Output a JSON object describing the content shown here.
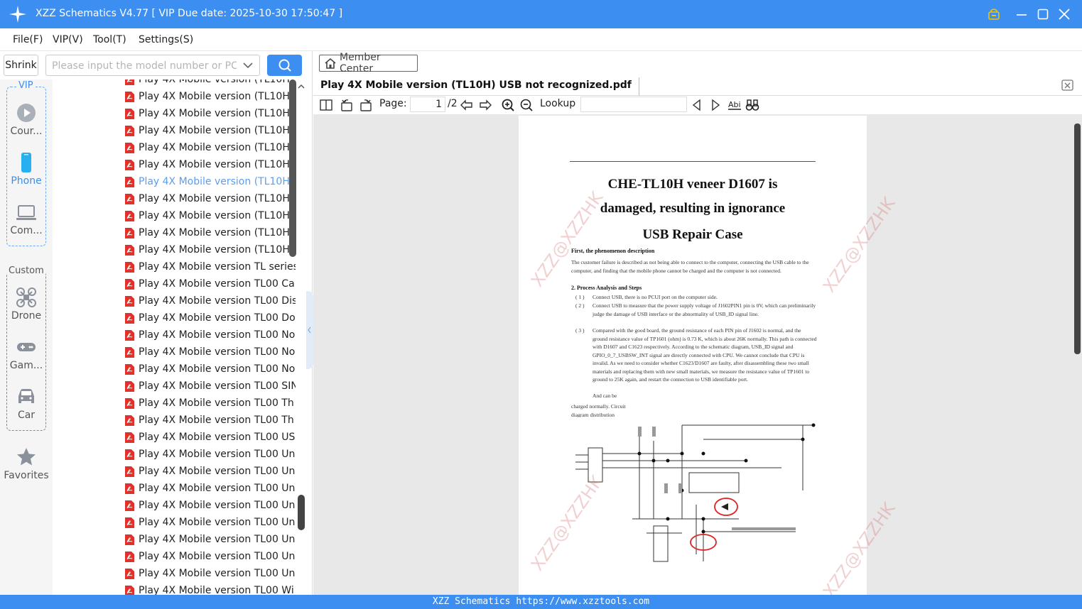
{
  "app": {
    "title": "XZZ Schematics V4.77 [ VIP Due date: 2025-10-30 17:50:47 ]",
    "accent_color": "#3c8ef0"
  },
  "menu": [
    "File(F)",
    "VIP(V)",
    "Tool(T)",
    "Settings(S)"
  ],
  "left": {
    "shrink_label": "Shrink",
    "search_placeholder": "Please input the model number or PCB",
    "vip_label": "VIP",
    "custom_label": "Custom",
    "categories_vip": [
      {
        "label": "Cour...",
        "icon": "play-circle-icon"
      },
      {
        "label": "Phone",
        "icon": "phone-icon"
      },
      {
        "label": "Com...",
        "icon": "laptop-icon"
      }
    ],
    "categories_custom": [
      {
        "label": "Drone",
        "icon": "drone-icon"
      },
      {
        "label": "Gam...",
        "icon": "gamepad-icon"
      },
      {
        "label": "Car",
        "icon": "car-icon"
      }
    ],
    "favorites_label": "Favorites",
    "files": [
      "Play 4X Mobile version (TL10H)",
      "Play 4X Mobile version (TL10H)",
      "Play 4X Mobile version (TL10H)",
      "Play 4X Mobile version (TL10H)",
      "Play 4X Mobile version (TL10H)",
      "Play 4X Mobile version (TL10H)",
      "Play 4X Mobile version (TL10H)",
      "Play 4X Mobile version (TL10H)",
      "Play 4X Mobile version (TL10H)",
      "Play 4X Mobile version (TL10H)",
      "Play 4X Mobile version (TL10H)",
      "Play 4X Mobile version TL series",
      "Play 4X Mobile version TL00 Ca:",
      "Play 4X Mobile version TL00 Dis",
      "Play 4X Mobile version TL00 Do",
      "Play 4X Mobile version TL00 No",
      "Play 4X Mobile version TL00 No",
      "Play 4X Mobile version TL00 No",
      "Play 4X Mobile version TL00 SIN",
      "Play 4X Mobile version TL00 Th",
      "Play 4X Mobile version TL00 Th",
      "Play 4X Mobile version TL00 US",
      "Play 4X Mobile version TL00 Un",
      "Play 4X Mobile version TL00 Un",
      "Play 4X Mobile version TL00 Un",
      "Play 4X Mobile version TL00 Un",
      "Play 4X Mobile version TL00 Un",
      "Play 4X Mobile version TL00 Un",
      "Play 4X Mobile version TL00 Un",
      "Play 4X Mobile version TL00 Un",
      "Play 4X Mobile version TL00 Wi"
    ],
    "selected_index": 6
  },
  "right": {
    "member_center": "Member Center",
    "tab_title": "Play 4X Mobile version (TL10H) USB not recognized.pdf",
    "page_label": "Page:",
    "page_current": "1",
    "page_total": "/2",
    "lookup_label": "Lookup",
    "lookup_value": ""
  },
  "doc": {
    "title1": "CHE-TL10H veneer D1607 is",
    "title2": "damaged, resulting in ignorance",
    "title3": "USB Repair Case",
    "h1": "First, the phenomenon description",
    "p1": "The customer failure is described as not being able to connect to the computer, connecting the USB cable to the computer, and finding that the mobile phone cannot be charged and the computer is not connected.",
    "h2": "2. Process Analysis and Steps",
    "s1": "Connect USB, there is no PCUI port on the computer side.",
    "s2": "Connect USB to measure that the power supply voltage of J1602PIN1 pin is 0V, which can preliminarily judge the damage of USB interface or the abnormality of USB_ID signal line.",
    "s3": "Compared with the good board, the ground resistance of each PIN pin of J1602 is normal, and the ground resistance value of TP1601 (ohm) is 0.73 K, which is about 26K normally. This path is connected with D1607 and C1623 respectively. According to the schematic diagram, USB_ID signal and GPIO_0_7_USBSW_INT signal are directly connected with CPU. We cannot conclude that CPU is invalid. As we need to consider whether C1623/D1607 are faulty, after disassembling these two small materials and replacing them with new small materials, we measure the resistance value of TP1601 to ground to 25K again, and restart the connection to USB identifiable port.",
    "s3b": "And can be",
    "p2": "charged normally. Circuit",
    "p3": "diagram distribution",
    "n1": "( 1 )",
    "n2": "( 2 )",
    "n3": "( 3 )"
  },
  "footer": "XZZ Schematics https://www.xzztools.com"
}
